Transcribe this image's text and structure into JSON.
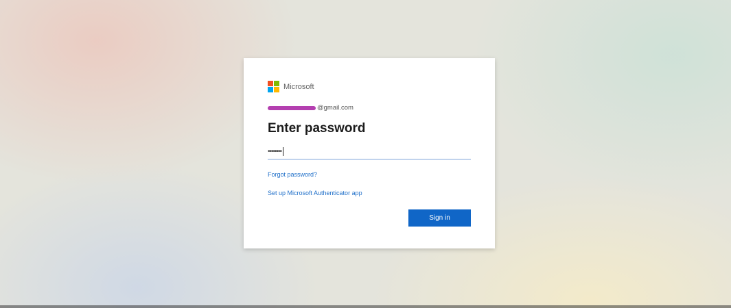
{
  "page": {
    "background_colors": [
      "#ecc8be",
      "#cdd7e6",
      "#cde1d7",
      "#f5ebc8"
    ]
  },
  "brand": {
    "name": "Microsoft",
    "logo_colors": [
      "#f25022",
      "#7fba00",
      "#00a4ef",
      "#ffb900"
    ]
  },
  "account": {
    "email_visible_suffix": "@gmail.com"
  },
  "form": {
    "title": "Enter password",
    "password_masked": "••••••••",
    "forgot_link": "Forgot password?",
    "setup_link": "Set up Microsoft Authenticator app",
    "sign_in_label": "Sign in",
    "sign_in_color": "#1066c7",
    "link_color": "#1f6fc9"
  }
}
